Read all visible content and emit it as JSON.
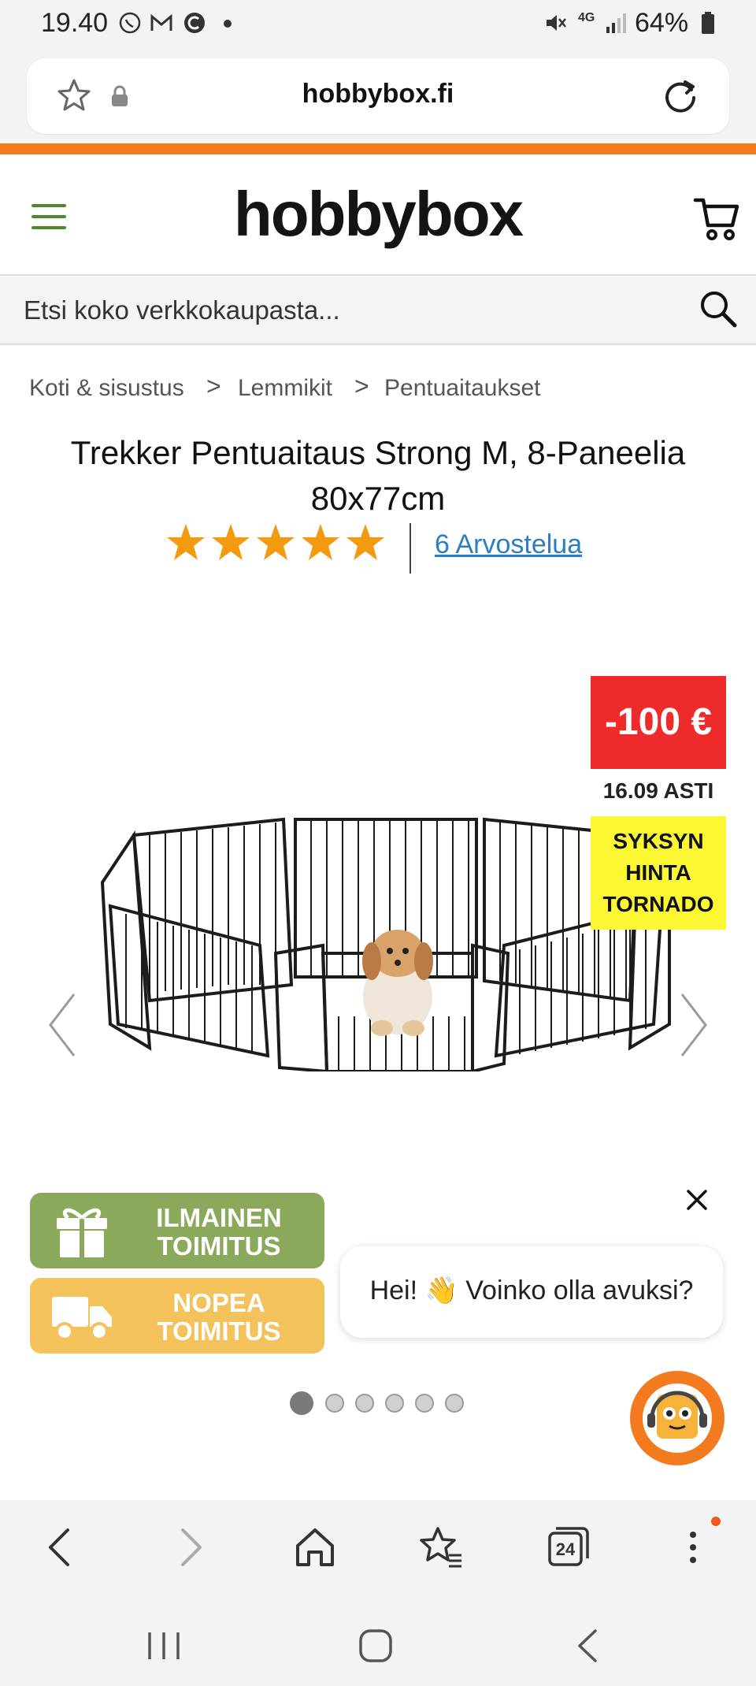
{
  "status_bar": {
    "time": "19.40",
    "battery": "64%",
    "network": "4G"
  },
  "browser": {
    "url": "hobbybox.fi",
    "tab_count": "24"
  },
  "header": {
    "logo_text": "hobbybox"
  },
  "search": {
    "placeholder": "Etsi koko verkkokaupasta..."
  },
  "breadcrumb": {
    "items": [
      "Koti & sisustus",
      "Lemmikit",
      "Pentuaitaukset"
    ],
    "separator": ">"
  },
  "product": {
    "title_line1": "Trekker Pentuaitaus Strong M, 8-Paneelia",
    "title_line2": "80x77cm",
    "rating_stars": 5,
    "reviews_label": "6 Arvostelua",
    "discount_badge": "-100 €",
    "valid_until": "16.09 ASTI",
    "campaign_line1": "SYKSYN",
    "campaign_line2": "HINTA",
    "campaign_line3": "TORNADO"
  },
  "gallery": {
    "image_count": 6,
    "active_index": 0
  },
  "promos": {
    "free_shipping_line1": "ILMAINEN",
    "free_shipping_line2": "TOIMITUS",
    "fast_shipping_line1": "NOPEA",
    "fast_shipping_line2": "TOIMITUS"
  },
  "chat": {
    "greeting": "Hei! 👋 Voinko olla avuksi?"
  },
  "colors": {
    "brand_orange": "#f47a1f",
    "discount_red": "#ee2a2a",
    "campaign_yellow": "#fbf733",
    "promo_green": "#8aa95b",
    "promo_yellow": "#f4c25a",
    "link_blue": "#2a7ec2",
    "star_orange": "#f39a0e"
  }
}
